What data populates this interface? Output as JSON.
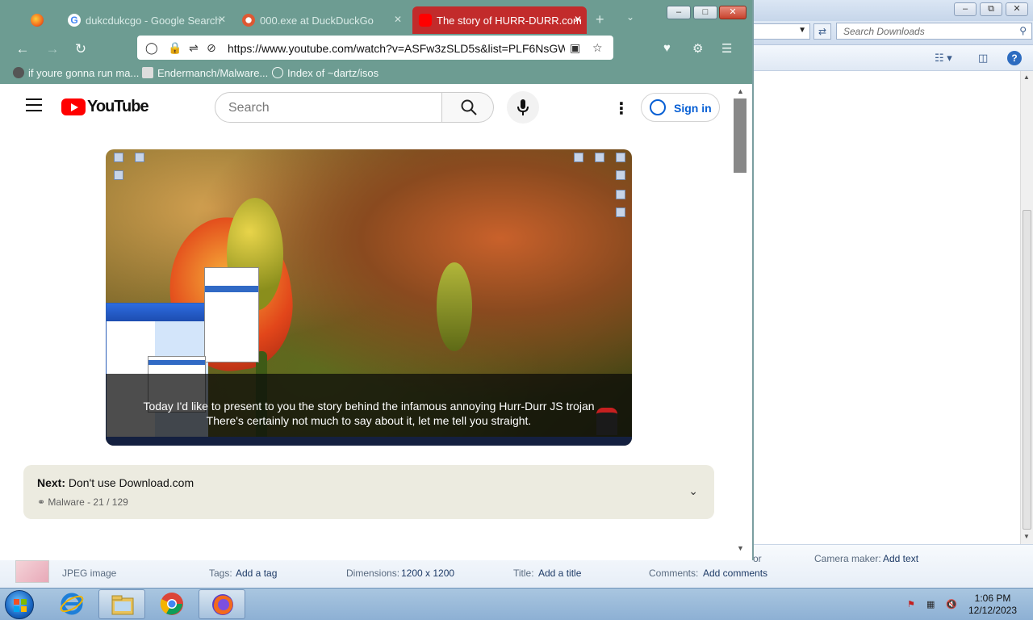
{
  "firefox": {
    "tabs": [
      {
        "label": "",
        "icon": "firefox-icon"
      },
      {
        "label": "dukcdukcgo - Google Search",
        "icon": "google-icon"
      },
      {
        "label": "000.exe at DuckDuckGo",
        "icon": "duckduckgo-icon"
      },
      {
        "label": "The story of HURR-DURR.com",
        "icon": "youtube-icon",
        "active": true
      }
    ],
    "new_tab": "+",
    "url": "https://www.youtube.com/watch?v=ASFw3zSLD5s&list=PLF6NsGW",
    "bookmarks": [
      {
        "label": "if youre gonna run ma...",
        "icon": "bookmark-favicon"
      },
      {
        "label": "Endermanch/Malware...",
        "icon": "github-icon"
      },
      {
        "label": "Index of ~dartz/isos",
        "icon": "globe-icon"
      }
    ]
  },
  "youtube": {
    "logo": "YouTube",
    "search_placeholder": "Search",
    "sign_in": "Sign in",
    "captions": [
      "Today I'd like to present to you the story behind the infamous annoying Hurr-Durr JS trojan",
      "There's certainly not much to say about it, let me tell you straight."
    ],
    "next_prefix": "Next:",
    "next_title": "Don't use Download.com",
    "playlist": "Malware - 21 / 129"
  },
  "explorer": {
    "search_placeholder": "Search Downloads",
    "details": {
      "type": "JPEG image",
      "tags_label": "Tags:",
      "tags_value": "Add a tag",
      "dimensions_label": "Dimensions:",
      "dimensions_value": "1200 x 1200",
      "title_label": "Title:",
      "title_value": "Add a title",
      "comments_label": "Comments:",
      "comments_value": "Add comments",
      "partial_label": "or",
      "camera_label": "Camera maker:",
      "camera_value": "Add text"
    }
  },
  "taskbar": {
    "apps": [
      "internet-explorer-icon",
      "windows-explorer-icon",
      "chrome-icon",
      "firefox-icon"
    ],
    "time": "1:06 PM",
    "date": "12/12/2023"
  },
  "colors": {
    "firefox_toolbar": "#6d9c92",
    "youtube_red": "#ff0000",
    "signin_blue": "#065fd4",
    "active_tab_red": "#c22b2b"
  }
}
